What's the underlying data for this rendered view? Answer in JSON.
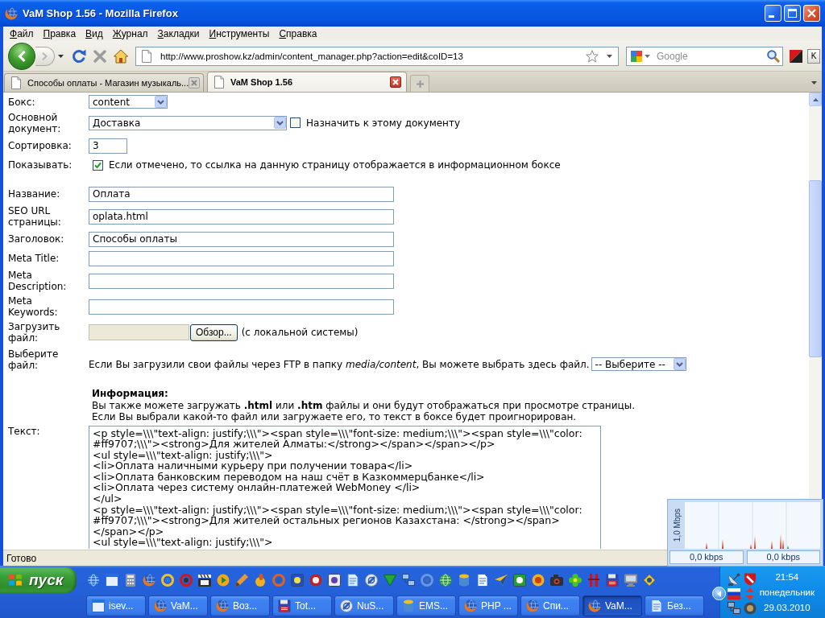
{
  "window": {
    "title": "VaM Shop 1.56 - Mozilla Firefox"
  },
  "menu": [
    "Файл",
    "Правка",
    "Вид",
    "Журнал",
    "Закладки",
    "Инструменты",
    "Справка"
  ],
  "navigation": {
    "address": "http://www.proshow.kz/admin/content_manager.php?action=edit&coID=13",
    "search_placeholder": "Google",
    "extra_button": "K"
  },
  "tabs": [
    {
      "label": "Способы оплаты - Магазин музыкаль...",
      "selected": false
    },
    {
      "label": "VaM Shop 1.56",
      "selected": true
    }
  ],
  "form": {
    "box": {
      "label": "Бокс:",
      "value": "content"
    },
    "parent_document": {
      "label": "Основной документ:",
      "value": "Доставка",
      "checkbox": {
        "label": "Назначить к этому документу",
        "checked": false
      }
    },
    "sort_order": {
      "label": "Сортировка:",
      "value": "3"
    },
    "show": {
      "label": "Показывать:",
      "checkbox": {
        "label": "Если отмечено, то ссылка на данную страницу отображается в информационном боксе",
        "checked": true
      }
    },
    "fields": [
      {
        "label": "Название:",
        "value": "Оплата"
      },
      {
        "label": "SEO URL страницы:",
        "value": "oplata.html"
      },
      {
        "label": "Заголовок:",
        "value": "Способы оплаты"
      },
      {
        "label": "Meta Title:"
      },
      {
        "label": "Meta Description:"
      },
      {
        "label": "Meta Keywords:"
      }
    ],
    "upload": {
      "label": "Загрузить файл:",
      "button": "Обзор...",
      "note": "(с локальной системы)"
    },
    "choose_file": {
      "label": "Выберите файл:",
      "text": "Если Вы загрузили свои файлы через FTP в папку *media/content*, Вы можете выбрать здесь файл.",
      "select": "-- Выберите --"
    },
    "info": {
      "title": "Информация:",
      "lines": [
        "Вы также можете загружать **.html** или **.htm** файлы и они будут отображаться при просмотре страницы.",
        "Если Вы выбрали какой-то файл или загружаете его, то текст в боксе будет проигнорирован."
      ]
    },
    "text": {
      "label": "Текст:",
      "lines": [
        "<p style=\\\\\\\"text-align: justify;\\\\\\\"><span style=\\\\\\\"font-size: medium;\\\\\\\"><span style=\\\\\\\"color:",
        "#ff9707;\\\\\\\"><strong>Для жителей Алматы:</strong></span></span></p>",
        "<ul style=\\\\\\\"text-align: justify;\\\\\\\">",
        "<li>Оплата наличными курьеру при получении товара</li>",
        "<li>Оплата банковским переводом на наш счёт в Казкоммерцбанке</li>",
        "<li>Оплата через систему онлайн-платежей WebMoney </li>",
        "</ul>",
        "<p style=\\\\\\\"text-align: justify;\\\\\\\"><span style=\\\\\\\"font-size: medium;\\\\\\\"><span style=\\\\\\\"color:",
        "#ff9707;\\\\\\\"><strong>Для жителей остальных регионов Казахстана: </strong></span>",
        "</span></p>",
        "<ul style=\\\\\\\"text-align: justify;\\\\\\\">"
      ]
    }
  },
  "status_bar": {
    "text": "Готово"
  },
  "network_meter": {
    "scale": "1,0 Mbps",
    "readings": [
      "0,0 kbps",
      "0,0 kbps"
    ]
  },
  "taskbar": {
    "start": "пуск",
    "tasks": [
      {
        "label": "isev...",
        "selected": false
      },
      {
        "label": "VaM...",
        "selected": false
      },
      {
        "label": "Воз...",
        "selected": false
      },
      {
        "label": "Tot...",
        "selected": false
      },
      {
        "label": "NuS...",
        "selected": false
      },
      {
        "label": "EMS...",
        "selected": false
      },
      {
        "label": "PHP ...",
        "selected": false
      },
      {
        "label": "Спи...",
        "selected": false
      },
      {
        "label": "VaM...",
        "selected": true
      },
      {
        "label": "Без...",
        "selected": false
      }
    ],
    "clock": {
      "time": "21:54",
      "day": "понедельник",
      "date": "29.03.2010"
    }
  }
}
